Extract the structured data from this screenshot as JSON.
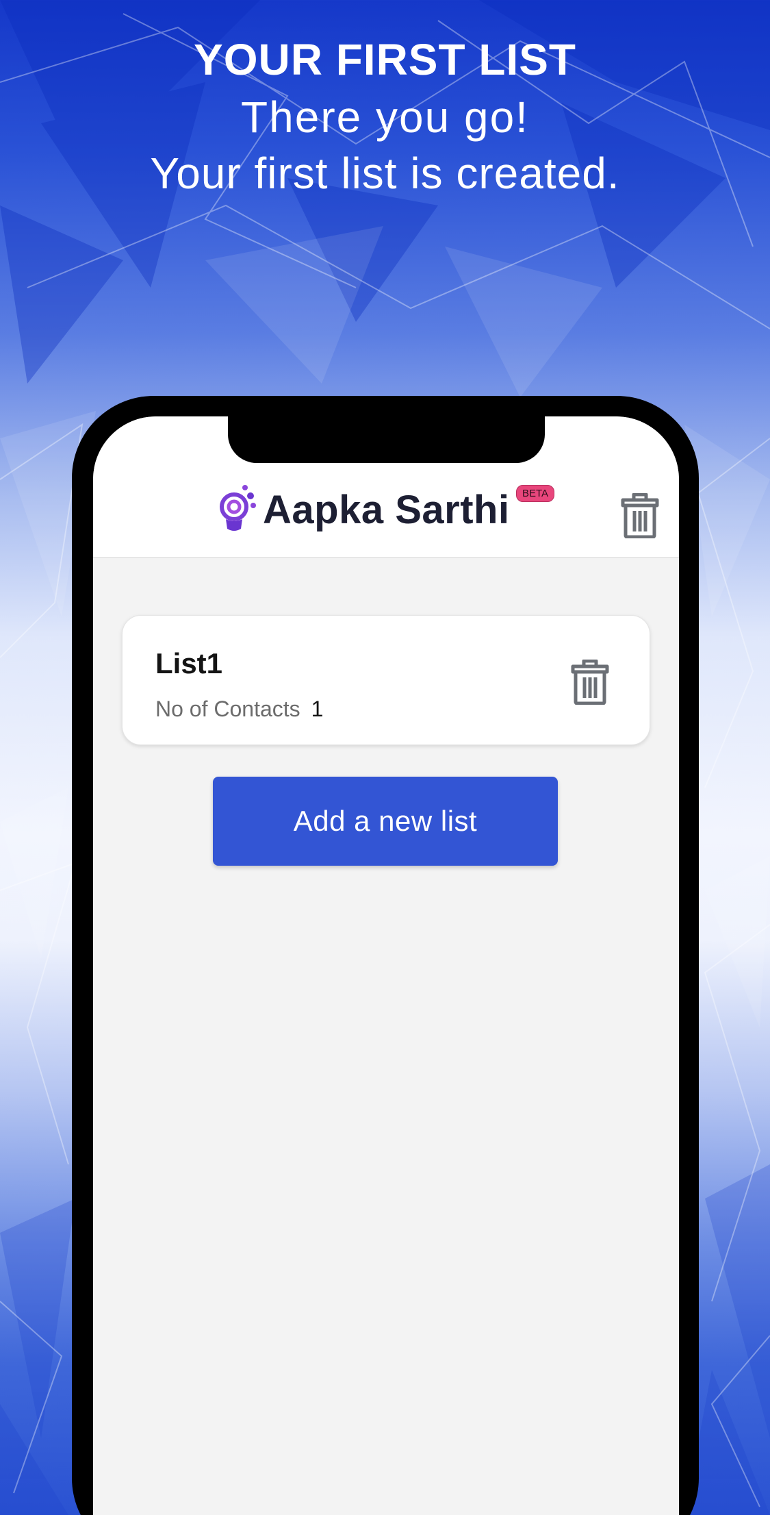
{
  "banner": {
    "title": "YOUR FIRST LIST",
    "line1": "There you go!",
    "line2": "Your first list is created."
  },
  "app": {
    "brand_name": "Aapka Sarthi",
    "badge": "BETA",
    "header_action_icon": "trash-icon"
  },
  "lists": [
    {
      "name": "List1",
      "contacts_label": "No of Contacts",
      "contacts_count": "1",
      "action_icon": "trash-icon"
    }
  ],
  "actions": {
    "add_list_label": "Add a new list"
  },
  "colors": {
    "primary": "#3355d4",
    "badge": "#e8467c",
    "icon_gray": "#6b6f75",
    "brand_text": "#1d1f33"
  }
}
